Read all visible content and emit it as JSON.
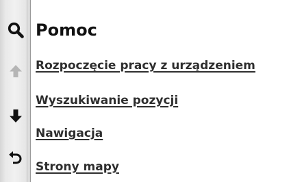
{
  "page": {
    "title": "Pomoc"
  },
  "sidebar": {
    "buttons": [
      {
        "icon": "search-icon",
        "enabled": true
      },
      {
        "icon": "arrow-up-icon",
        "enabled": false
      },
      {
        "icon": "arrow-down-icon",
        "enabled": true
      },
      {
        "icon": "back-icon",
        "enabled": true
      }
    ]
  },
  "menu": {
    "items": [
      {
        "label": "Rozpoczęcie pracy z urządzeniem"
      },
      {
        "label": "Wyszukiwanie pozycji"
      },
      {
        "label": "Nawigacja"
      },
      {
        "label": "Strony mapy"
      }
    ]
  },
  "colors": {
    "text": "#2e2e2e",
    "title": "#111111",
    "icon_active": "#111111",
    "icon_disabled": "#b5b5b5",
    "background": "#ffffff"
  }
}
